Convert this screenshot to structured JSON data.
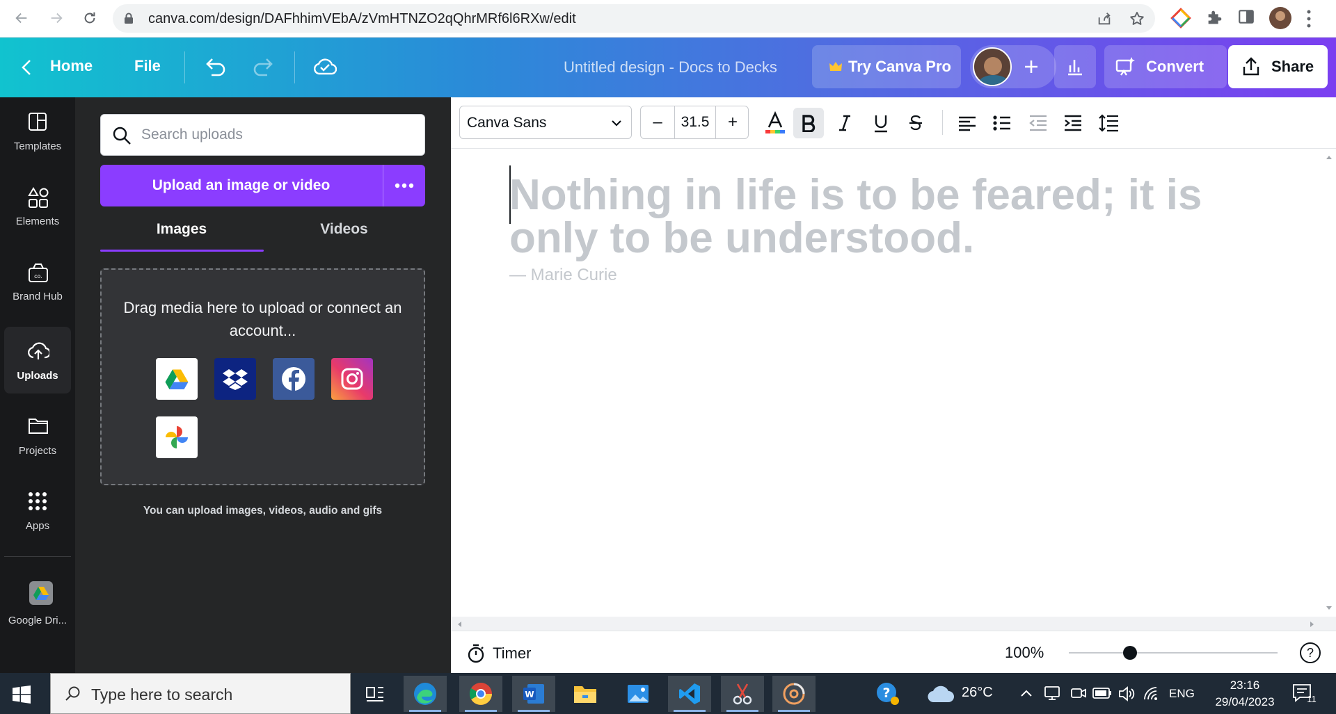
{
  "browser": {
    "url": "canva.com/design/DAFhhimVEbA/zVmHTNZO2qQhrMRf6l6RXw/edit"
  },
  "header": {
    "home_label": "Home",
    "file_label": "File",
    "title": "Untitled design - Docs to Decks",
    "try_pro_label": "Try Canva Pro",
    "convert_label": "Convert",
    "share_label": "Share"
  },
  "sidebar": {
    "items": [
      {
        "label": "Templates",
        "icon": "templates-icon"
      },
      {
        "label": "Elements",
        "icon": "elements-icon"
      },
      {
        "label": "Brand Hub",
        "icon": "brand-hub-icon"
      },
      {
        "label": "Uploads",
        "icon": "uploads-icon"
      },
      {
        "label": "Projects",
        "icon": "projects-icon"
      },
      {
        "label": "Apps",
        "icon": "apps-icon"
      },
      {
        "label": "Google Dri...",
        "icon": "google-drive-icon"
      }
    ],
    "active": "Uploads"
  },
  "uploads": {
    "search_placeholder": "Search uploads",
    "upload_button": "Upload an image or video",
    "tabs": [
      "Images",
      "Videos"
    ],
    "active_tab": "Images",
    "drop_text": "Drag media here to upload or connect an account...",
    "sources": [
      "Google Drive",
      "Dropbox",
      "Facebook",
      "Instagram",
      "Google Photos"
    ],
    "hint": "You can upload images, videos, audio and gifs"
  },
  "toolbar": {
    "font": "Canva Sans",
    "font_size": "31.5",
    "decrease": "–",
    "increase": "+"
  },
  "canvas": {
    "quote": "Nothing in life is to be feared; it is only to be understood.",
    "author": "— Marie Curie"
  },
  "footer": {
    "timer_label": "Timer",
    "zoom": "100%",
    "zoom_level": 100,
    "help": "?"
  },
  "taskbar": {
    "search_text": "Type here to search",
    "temperature": "26°C",
    "language": "ENG",
    "time": "23:16",
    "date": "29/04/2023",
    "notifications": "11"
  },
  "colors": {
    "accent": "#8b3dff",
    "header_start": "#11c3cf",
    "header_end": "#7b3ff0",
    "panel": "#252627",
    "nav": "#18191b",
    "placeholder_text": "#c4c8cd"
  }
}
